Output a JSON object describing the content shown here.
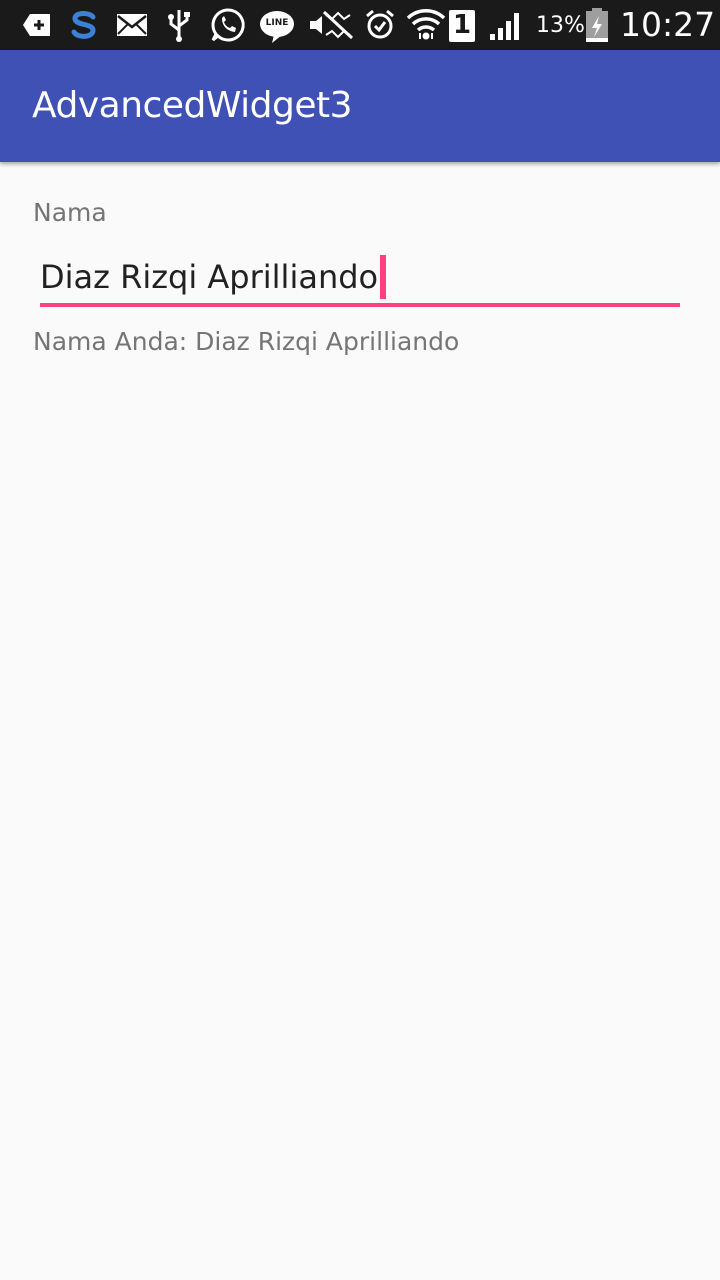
{
  "status_bar": {
    "battery_percent": "13%",
    "time": "10:27",
    "sim_number": "1",
    "line_label": "LINE",
    "icons": [
      "add-notification-icon",
      "s-app-icon",
      "mail-icon",
      "usb-icon",
      "whatsapp-icon",
      "line-icon",
      "mute-icon",
      "alarm-icon",
      "wifi-icon",
      "sim-icon",
      "signal-icon",
      "battery-icon"
    ]
  },
  "app_bar": {
    "title": "AdvancedWidget3"
  },
  "form": {
    "label": "Nama",
    "input_value": "Diaz Rizqi Aprilliando",
    "result_text": "Nama Anda: Diaz Rizqi Aprilliando"
  },
  "colors": {
    "app_bar": "#3f51b5",
    "accent": "#ff4081",
    "status_bar": "#1a1a1a",
    "background": "#fafafa",
    "secondary_text": "#757575",
    "primary_text": "#212121"
  }
}
